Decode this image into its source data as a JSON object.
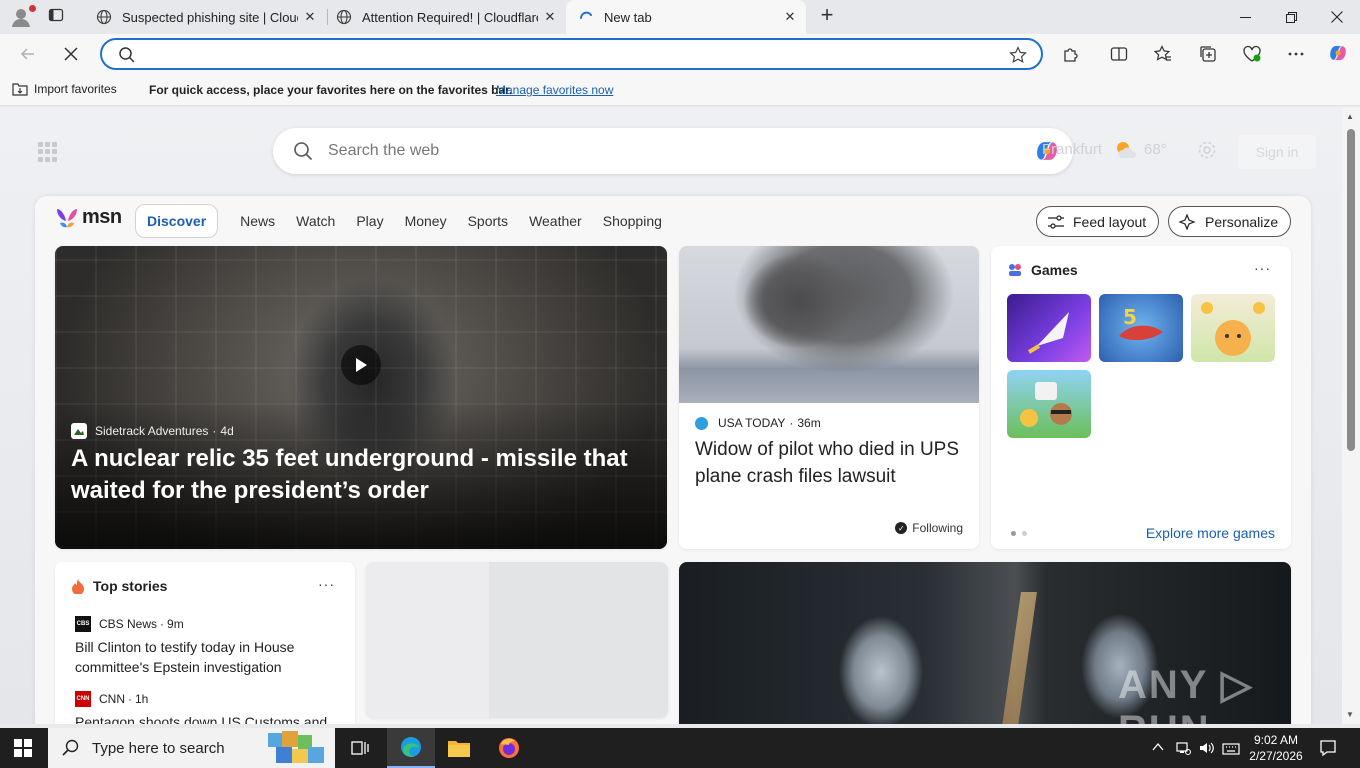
{
  "browser": {
    "tabs": [
      {
        "title": "Suspected phishing site | Cloudflare",
        "close": "✕"
      },
      {
        "title": "Attention Required! | Cloudflare",
        "close": "✕"
      },
      {
        "title": "New tab",
        "close": "✕",
        "active": true
      }
    ],
    "new_tab": "+",
    "window_controls": {
      "minimize": "—",
      "restore": "❐",
      "close": "✕"
    },
    "address_value": "",
    "favorites_bar": {
      "import_label": "Import favorites",
      "message": "For quick access, place your favorites here on the favorites bar.",
      "manage_link": "Manage favorites now"
    }
  },
  "newtab": {
    "search_placeholder": "Search the web",
    "location": "Frankfurt",
    "temperature": "68°",
    "signin": "Sign in"
  },
  "msn": {
    "brand": "msn",
    "nav": [
      "Discover",
      "News",
      "Watch",
      "Play",
      "Money",
      "Sports",
      "Weather",
      "Shopping"
    ],
    "feed_layout_label": "Feed layout",
    "personalize_label": "Personalize",
    "hero": {
      "source": "Sidetrack Adventures",
      "age": "4d",
      "title": "A nuclear relic 35 feet underground - missile that waited for the president’s order"
    },
    "news_card": {
      "source": "USA TODAY",
      "age": "36m",
      "title": "Widow of pilot who died in UPS plane crash files lawsuit",
      "following": "Following"
    },
    "games": {
      "title": "Games",
      "more": "···",
      "explore": "Explore more games"
    },
    "top_stories": {
      "title": "Top stories",
      "more": "···",
      "items": [
        {
          "source": "CBS News",
          "age": "9m",
          "title": "Bill Clinton to testify today in House committee's Epstein investigation"
        },
        {
          "source": "CNN",
          "age": "1h",
          "title": "Pentagon shoots down US Customs and"
        }
      ]
    },
    "watermark": "ANY ▷ RUN"
  },
  "taskbar": {
    "search_placeholder": "Type here to search",
    "time": "9:02 AM",
    "date": "2/27/2026"
  },
  "colors": {
    "accent": "#1f6fd1",
    "link": "#1a5fb4",
    "taskbar": "#1f1f1f"
  }
}
